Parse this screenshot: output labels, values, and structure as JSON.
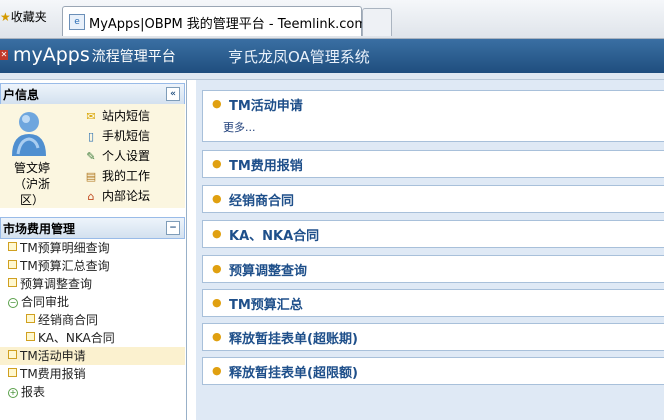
{
  "browser": {
    "favorites": "收藏夹",
    "tab_title": "MyApps|OBPM 我的管理平台 - Teemlink.com"
  },
  "header": {
    "brand": "myApps",
    "brand_sub": "流程管理平台",
    "system_title": "亨氏龙凤OA管理系统"
  },
  "user_panel": {
    "title": "户信息",
    "collapse": "«",
    "name_lines": [
      "管文婷",
      "（沪浙",
      "区）"
    ],
    "links": [
      {
        "icon": "envelope-icon",
        "glyph": "✉",
        "label": "站内短信"
      },
      {
        "icon": "phone-icon",
        "glyph": "▯",
        "label": "手机短信"
      },
      {
        "icon": "edit-icon",
        "glyph": "✎",
        "label": "个人设置"
      },
      {
        "icon": "work-icon",
        "glyph": "▤",
        "label": "我的工作"
      },
      {
        "icon": "forum-icon",
        "glyph": "⌂",
        "label": "内部论坛"
      }
    ]
  },
  "menu_panel": {
    "title": "市场费用管理",
    "collapse": "−",
    "items": [
      {
        "label": "TM预算明细查询",
        "type": "leaf",
        "indent": 0
      },
      {
        "label": "TM预算汇总查询",
        "type": "leaf",
        "indent": 0
      },
      {
        "label": "预算调整查询",
        "type": "leaf",
        "indent": 0
      },
      {
        "label": "合同审批",
        "type": "folder",
        "indent": 0
      },
      {
        "label": "经销商合同",
        "type": "leaf",
        "indent": 1
      },
      {
        "label": "KA、NKA合同",
        "type": "leaf",
        "indent": 1
      },
      {
        "label": "TM活动申请",
        "type": "leaf",
        "indent": 0,
        "selected": true
      },
      {
        "label": "TM费用报销",
        "type": "leaf",
        "indent": 0
      },
      {
        "label": "报表",
        "type": "folder",
        "indent": 0
      }
    ]
  },
  "content": {
    "panels": [
      {
        "title": "TM活动申请",
        "more": "更多..."
      },
      {
        "title": "TM费用报销"
      },
      {
        "title": "经销商合同"
      },
      {
        "title": "KA、NKA合同"
      },
      {
        "title": "预算调整查询"
      },
      {
        "title": "TM预算汇总"
      },
      {
        "title": "释放暂挂表单(超账期)"
      },
      {
        "title": "释放暂挂表单(超限额)"
      }
    ]
  },
  "colors": {
    "header": "#2a5d91",
    "panel_title": "#1e4f8a",
    "selected_bg": "#fbf1cf"
  }
}
